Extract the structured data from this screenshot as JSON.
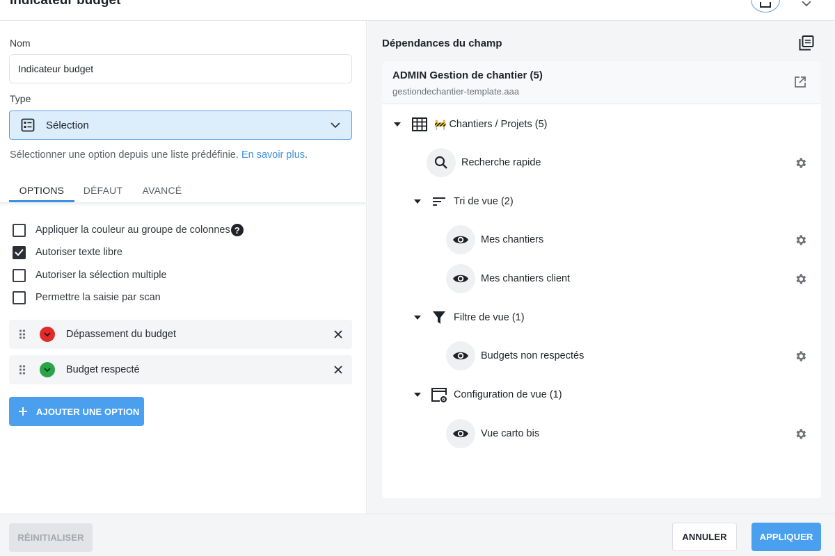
{
  "header": {
    "title": "Indicateur budget"
  },
  "left": {
    "name_label": "Nom",
    "name_value": "Indicateur budget",
    "type_label": "Type",
    "type_value": "Sélection",
    "help_text": "Sélectionner une option depuis une liste prédéfinie. ",
    "help_link": "En savoir plus",
    "help_period": ".",
    "tabs": [
      {
        "label": "OPTIONS",
        "active": true
      },
      {
        "label": "DÉFAUT",
        "active": false
      },
      {
        "label": "AVANCÉ",
        "active": false
      }
    ],
    "checkboxes": [
      {
        "label": "Appliquer la couleur au groupe de colonnes",
        "checked": false,
        "help": true
      },
      {
        "label": "Autoriser texte libre",
        "checked": true
      },
      {
        "label": "Autoriser la sélection multiple",
        "checked": false
      },
      {
        "label": "Permettre la saisie par scan",
        "checked": false
      }
    ],
    "options": [
      {
        "label": "Dépassement du budget",
        "color": "#e02b2b"
      },
      {
        "label": "Budget respecté",
        "color": "#2aa447"
      }
    ],
    "add_option_label": "AJOUTER UNE OPTION"
  },
  "right": {
    "title": "Dépendances du champ",
    "app_name": "ADMIN Gestion de chantier (5)",
    "app_domain": "gestiondechantier-template.aaa",
    "tree": {
      "table_emoji": "🚧",
      "table_label": "Chantiers / Projets (5)",
      "quick_search": "Recherche rapide",
      "sort_label": "Tri de vue (2)",
      "sort_items": [
        "Mes chantiers",
        "Mes chantiers client"
      ],
      "filter_label": "Filtre de vue (1)",
      "filter_items": [
        "Budgets non respectés"
      ],
      "config_label": "Configuration de vue (1)",
      "config_items": [
        "Vue carto bis"
      ]
    }
  },
  "footer": {
    "reset_label": "RÉINITIALISER",
    "cancel_label": "ANNULER",
    "apply_label": "APPLIQUER"
  },
  "colors": {
    "accent": "#4aa0ee",
    "select_bg": "#dcedfb",
    "link": "#3d8fe0"
  }
}
